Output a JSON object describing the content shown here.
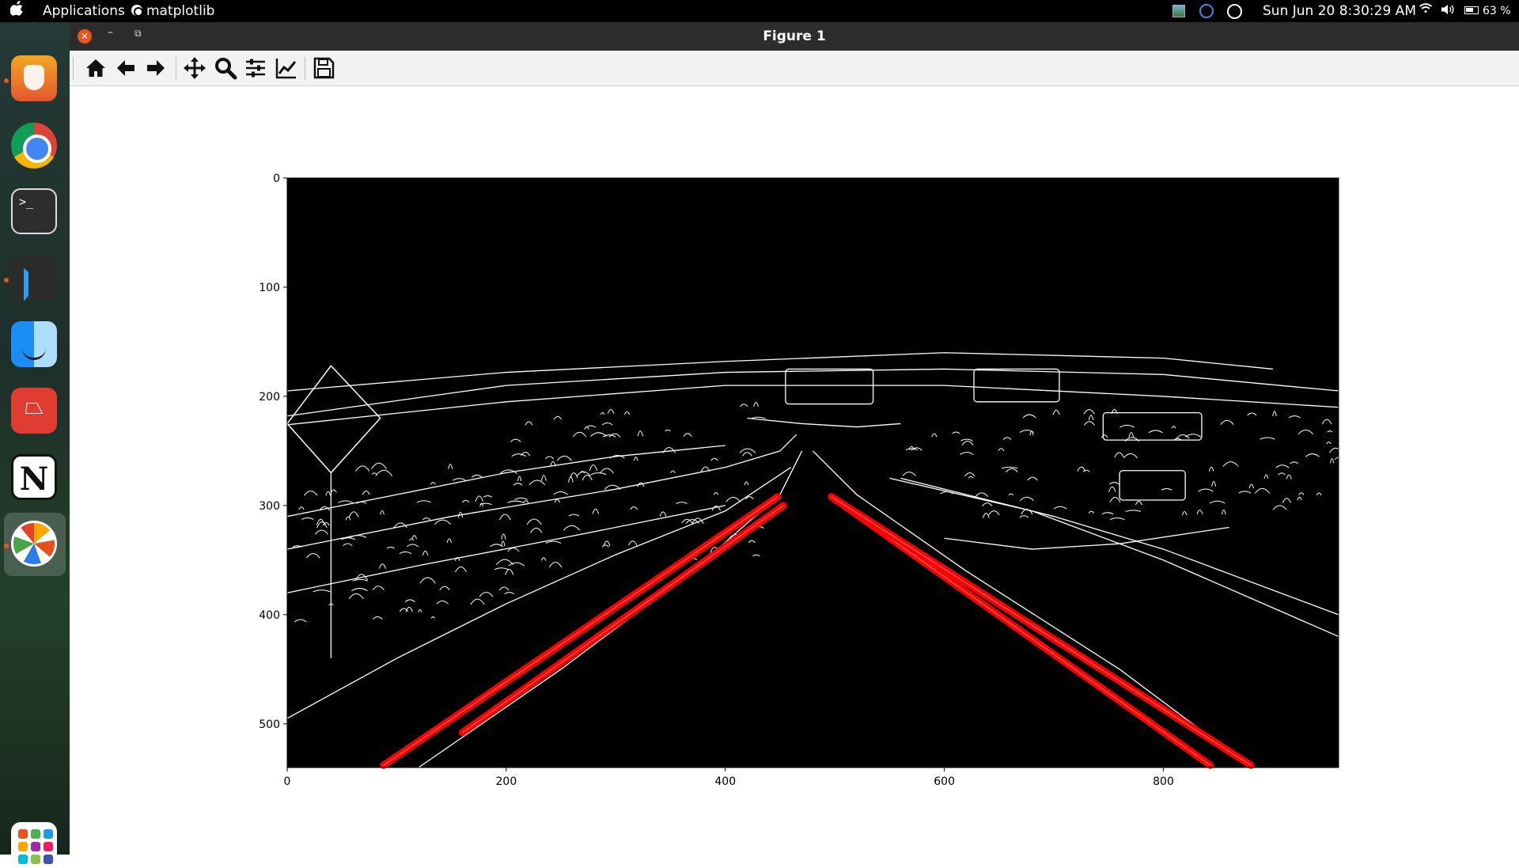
{
  "topbar": {
    "apps_label": "Applications",
    "active_app": "matplotlib",
    "clock": "Sun Jun 20  8:30:29 AM",
    "battery": "63 %"
  },
  "dock": {
    "items": [
      "brave-browser",
      "google-chrome",
      "terminal",
      "vscode",
      "finder",
      "pdf-reader",
      "notion",
      "pinwheel-app",
      "show-applications"
    ],
    "terminal_glyph": ">_",
    "notion_glyph": "N",
    "grid_colors": [
      "#e95420",
      "#4caf50",
      "#2196f3",
      "#f6a800",
      "#9c27b0",
      "#e91e63",
      "#00bcd4",
      "#8bc34a",
      "#3f51b5"
    ]
  },
  "window": {
    "title": "Figure 1",
    "close_glyph": "✕",
    "minimize_glyph": "–",
    "maximize_glyph": "⧉"
  },
  "toolbar": {
    "tools": [
      "home-icon",
      "back-arrow-icon",
      "forward-arrow-icon",
      "pan-icon",
      "zoom-icon",
      "subplots-config-icon",
      "edit-axis-icon",
      "save-icon"
    ]
  },
  "chart_data": {
    "type": "image",
    "title": "",
    "xlabel": "",
    "ylabel": "",
    "xlim": [
      0,
      960
    ],
    "ylim": [
      540,
      0
    ],
    "xticks": [
      0,
      200,
      400,
      600,
      800
    ],
    "yticks": [
      0,
      100,
      200,
      300,
      400,
      500
    ],
    "background": "#000000",
    "edge_color": "#ffffff",
    "lane_color": "#ff0000",
    "lane_lines": [
      {
        "name": "",
        "x1": 88,
        "y1": 538,
        "x2": 448,
        "y2": 292
      },
      {
        "name": "",
        "x1": 160,
        "y1": 508,
        "x2": 453,
        "y2": 300
      },
      {
        "name": "",
        "x1": 497,
        "y1": 292,
        "x2": 843,
        "y2": 538
      },
      {
        "name": "",
        "x1": 497,
        "y1": 292,
        "x2": 880,
        "y2": 538
      }
    ]
  }
}
